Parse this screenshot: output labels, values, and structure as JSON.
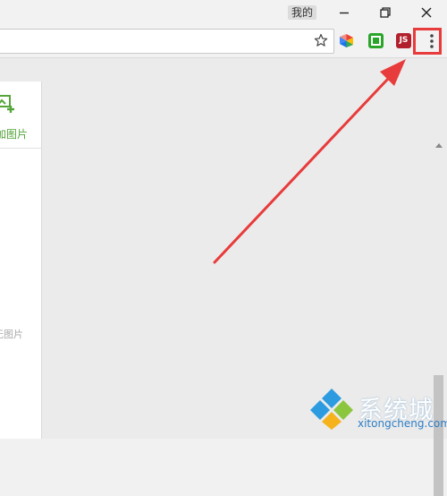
{
  "titlebar": {
    "profile_name": "我的",
    "minimize_icon": "minimize-icon",
    "restore_icon": "restore-icon",
    "close_icon": "close-icon"
  },
  "toolbar": {
    "bookmark_icon": "star-icon",
    "extensions": [
      "color-picker-extension",
      "green-box-extension",
      "js-extension"
    ],
    "js_extension_label": "JS",
    "menu_icon": "vertical-dots-icon"
  },
  "panel": {
    "upload_label": "添加图片",
    "empty_label": "暂无图片"
  },
  "annotation": {
    "color": "#e83b3b"
  },
  "watermark": {
    "text": "系统城",
    "url": "xitongcheng.com"
  }
}
